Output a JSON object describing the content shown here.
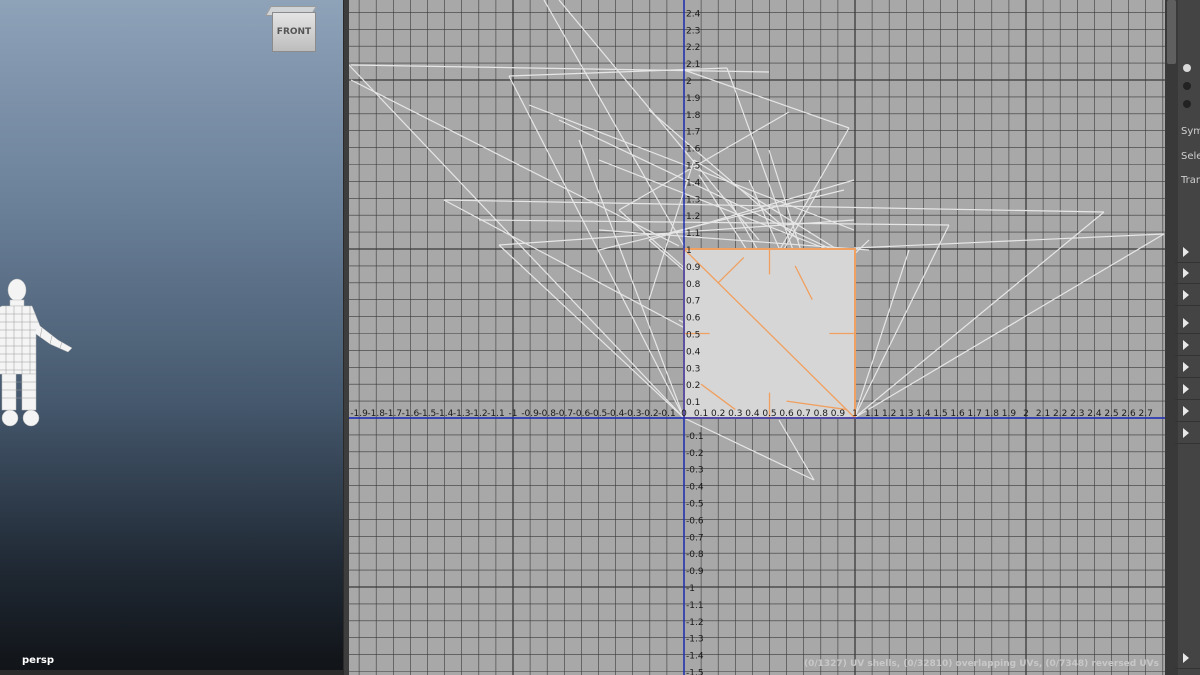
{
  "perspective_view": {
    "camera_label": "persp",
    "viewcube_label": "FRONT"
  },
  "uv_editor": {
    "x_ticks": [
      "-1.9",
      "-1.8",
      "-1.7",
      "-1.6",
      "-1.5",
      "-1.4",
      "-1.3",
      "-1.2",
      "-1.1",
      "-1",
      "-0.9",
      "-0.8",
      "-0.7",
      "-0.6",
      "-0.5",
      "-0.4",
      "-0.3",
      "-0.2",
      "-0.1",
      "0",
      "0.1",
      "0.2",
      "0.3",
      "0.4",
      "0.5",
      "0.6",
      "0.7",
      "0.8",
      "0.9",
      "1",
      "1.1",
      "1.2",
      "1.3",
      "1.4",
      "1.5",
      "1.6",
      "1.7",
      "1.8",
      "1.9",
      "2",
      "2.1",
      "2.2",
      "2.3",
      "2.4",
      "2.5",
      "2.6",
      "2.7"
    ],
    "y_ticks": [
      "2.4",
      "2.3",
      "2.2",
      "2.1",
      "2",
      "1.9",
      "1.8",
      "1.7",
      "1.6",
      "1.5",
      "1.4",
      "1.3",
      "1.2",
      "1.1",
      "1",
      "0.9",
      "0.8",
      "0.7",
      "0.6",
      "0.5",
      "0.4",
      "0.3",
      "0.2",
      "0.1",
      "-0.1",
      "-0.2",
      "-0.3",
      "-0.4",
      "-0.5",
      "-0.6",
      "-0.7",
      "-0.8",
      "-0.9",
      "-1",
      "-1.1",
      "-1.2",
      "-1.3",
      "-1.4",
      "-1.5"
    ],
    "status_text": "(0/1327) UV shells, (0/32810) overlapping UVs, (0/7348) reversed UVs",
    "colors": {
      "background": "#a8a8a8",
      "grid": "#3a3a3a",
      "axis": "#1f2fbd",
      "wireframe": "#e6e6e6",
      "selected": "#f0a060"
    }
  },
  "right_panel": {
    "labels": [
      "Sym",
      "Sele",
      "Tran"
    ],
    "radio_states": [
      true,
      false,
      false
    ],
    "expander_count": 11
  }
}
